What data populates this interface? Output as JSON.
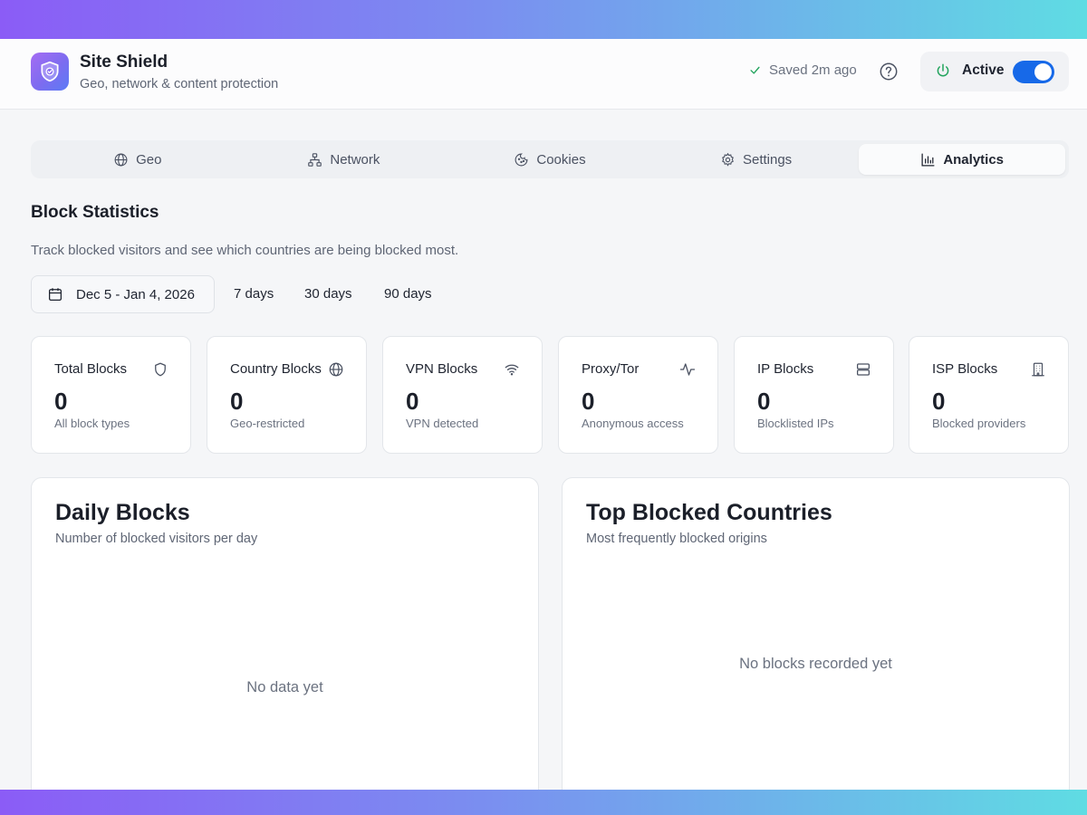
{
  "header": {
    "app_title": "Site Shield",
    "app_subtitle": "Geo, network & content protection",
    "saved_text": "Saved 2m ago",
    "status_label": "Active",
    "status_on": true
  },
  "tabs": [
    {
      "label": "Geo",
      "icon": "globe-icon"
    },
    {
      "label": "Network",
      "icon": "network-icon"
    },
    {
      "label": "Cookies",
      "icon": "cookie-icon"
    },
    {
      "label": "Settings",
      "icon": "gear-icon"
    },
    {
      "label": "Analytics",
      "icon": "bar-chart-icon",
      "active": true
    }
  ],
  "section": {
    "title": "Block Statistics",
    "description": "Track blocked visitors and see which countries are being blocked most."
  },
  "date_range": {
    "label": "Dec 5 - Jan 4, 2026",
    "presets": [
      "7 days",
      "30 days",
      "90 days"
    ]
  },
  "stats": [
    {
      "title": "Total Blocks",
      "value": "0",
      "desc": "All block types",
      "icon": "shield-icon"
    },
    {
      "title": "Country Blocks",
      "value": "0",
      "desc": "Geo-restricted",
      "icon": "globe-icon"
    },
    {
      "title": "VPN Blocks",
      "value": "0",
      "desc": "VPN detected",
      "icon": "wifi-icon"
    },
    {
      "title": "Proxy/Tor",
      "value": "0",
      "desc": "Anonymous access",
      "icon": "activity-icon"
    },
    {
      "title": "IP Blocks",
      "value": "0",
      "desc": "Blocklisted IPs",
      "icon": "server-icon"
    },
    {
      "title": "ISP Blocks",
      "value": "0",
      "desc": "Blocked providers",
      "icon": "building-icon"
    }
  ],
  "daily_panel": {
    "title": "Daily Blocks",
    "subtitle": "Number of blocked visitors per day",
    "empty_text": "No data yet"
  },
  "countries_panel": {
    "title": "Top Blocked Countries",
    "subtitle": "Most frequently blocked origins",
    "empty_text": "No blocks recorded yet"
  },
  "colors": {
    "accent": "#1769e8",
    "success": "#22a45d",
    "gradient_start": "#8b5cf6",
    "gradient_end": "#5fdce3"
  }
}
